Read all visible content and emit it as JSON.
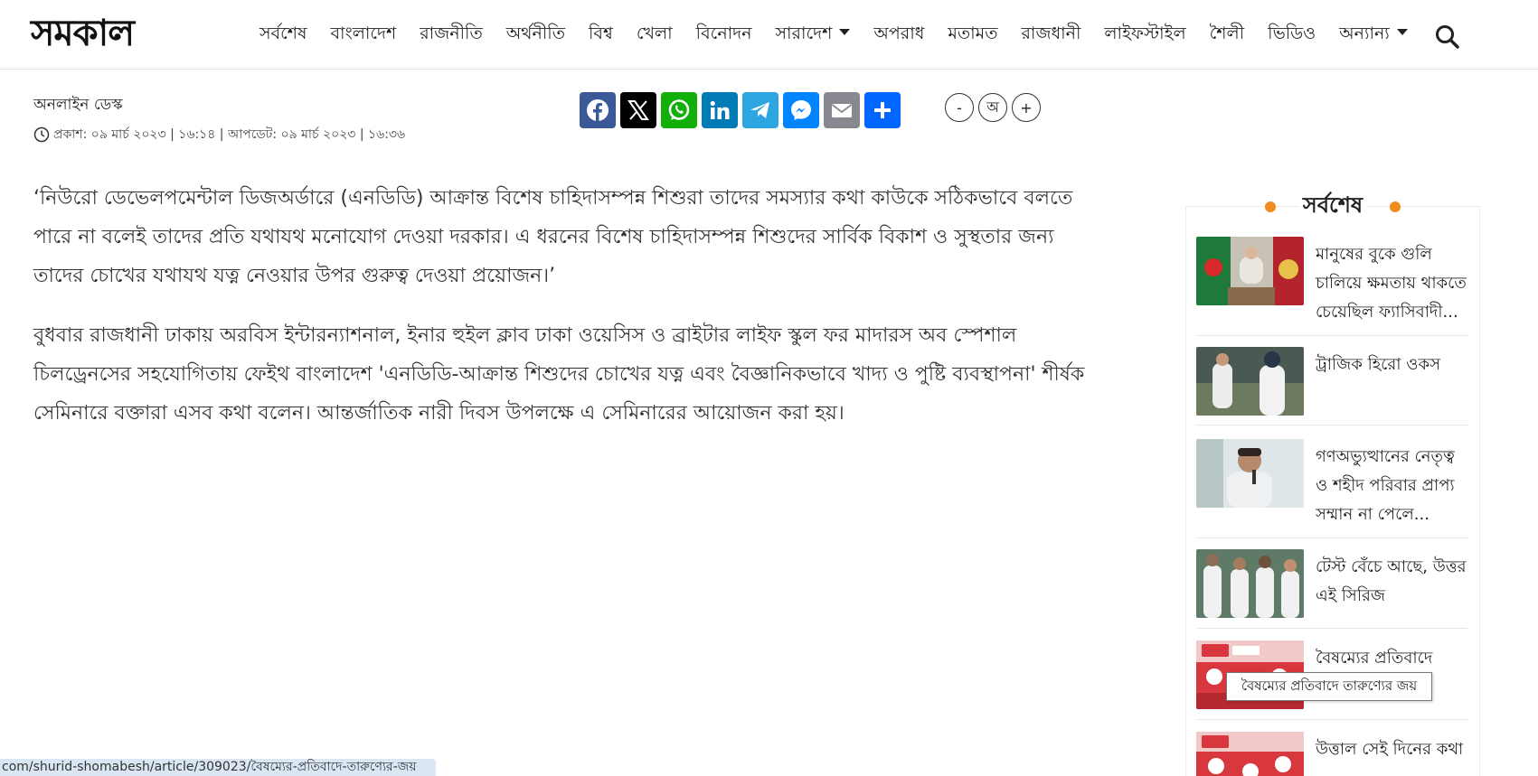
{
  "header": {
    "logo": "সমকাল",
    "nav": [
      {
        "label": "সর্বশেষ"
      },
      {
        "label": "বাংলাদেশ"
      },
      {
        "label": "রাজনীতি"
      },
      {
        "label": "অর্থনীতি"
      },
      {
        "label": "বিশ্ব"
      },
      {
        "label": "খেলা"
      },
      {
        "label": "বিনোদন"
      },
      {
        "label": "সারাদেশ"
      },
      {
        "label": "অপরাধ"
      },
      {
        "label": "মতামত"
      },
      {
        "label": "রাজধানী"
      },
      {
        "label": "লাইফস্টাইল"
      },
      {
        "label": "শৈলী"
      },
      {
        "label": "ভিডিও"
      },
      {
        "label": "অন্যান্য"
      }
    ],
    "search_icon": "search-icon"
  },
  "meta": {
    "author": "অনলাইন ডেস্ক",
    "dates": "প্রকাশ: ০৯ মার্চ ২০২৩ | ১৬:১৪ | আপডেট: ০৯ মার্চ ২০২৩ | ১৬:৩৬"
  },
  "share": {
    "buttons": [
      {
        "icon": "facebook-icon",
        "color": "#3b5998"
      },
      {
        "icon": "x-icon",
        "color": "#000000"
      },
      {
        "icon": "whatsapp-icon",
        "color": "#12af0a"
      },
      {
        "icon": "linkedin-icon",
        "color": "#007bb5"
      },
      {
        "icon": "telegram-icon",
        "color": "#2ca5e0"
      },
      {
        "icon": "messenger-icon",
        "color": "#0084ff"
      },
      {
        "icon": "email-icon",
        "color": "#888990"
      },
      {
        "icon": "share-icon",
        "color": "#0166ff"
      }
    ]
  },
  "font_controls": {
    "decrease": "-",
    "reset": "অ",
    "increase": "+"
  },
  "article": {
    "paragraphs": [
      "‘নিউরো ডেভেলপমেন্টাল ডিজঅর্ডারে (এনডিডি) আক্রান্ত বিশেষ চাহিদাসম্পন্ন শিশুরা তাদের সমস্যার কথা কাউকে সঠিকভাবে বলতে পারে না বলেই তাদের প্রতি যথাযথ মনোযোগ দেওয়া দরকার। এ ধরনের বিশেষ চাহিদাসম্পন্ন শিশুদের সার্বিক বিকাশ ও সুস্থতার জন্য তাদের চোখের যথাযথ যত্ন নেওয়ার উপর গুরুত্ব দেওয়া প্রয়োজন।’",
      "বুধবার রাজধানী ঢাকায় অরবিস ইন্টারন্যাশনাল, ইনার হুইল ক্লাব ঢাকা ওয়েসিস ও ব্রাইটার লাইফ স্কুল ফর মাদারস অব স্পেশাল চিলড্রেনসের সহযোগিতায় ফেইথ বাংলাদেশ  'এনডিডি-আক্রান্ত শিশুদের চোখের যত্ন এবং বৈজ্ঞানিকভাবে খাদ্য ও পুষ্টি ব্যবস্থাপনা' শীর্ষক সেমিনারে বক্তারা এসব কথা বলেন। আন্তর্জাতিক নারী দিবস উপলক্ষে এ সেমিনারের আয়োজন করা হয়।"
    ]
  },
  "sidebar": {
    "title": "সর্বশেষ",
    "accent": "#f08c1e",
    "items": [
      {
        "text": "মানুষের বুকে গুলি চালিয়ে ক্ষমতায় থাকতে চেয়েছিল ফ্যাসিবাদী..."
      },
      {
        "text": "ট্রাজিক হিরো ওকস"
      },
      {
        "text": "গণঅভ্যুত্থানের নেতৃত্ব ও শহীদ পরিবার প্রাপ্য সম্মান না পেলে..."
      },
      {
        "text": "টেস্ট বেঁচে আছে, উত্তর এই সিরিজ"
      },
      {
        "text": "বৈষম্যের প্রতিবাদে"
      },
      {
        "text": "উত্তাল সেই দিনের কথা"
      }
    ]
  },
  "tooltip": "বৈষম্যের প্রতিবাদে তারুণ্যের জয়",
  "status_url": "com/shurid-shomabesh/article/309023/বৈষম্যের-প্রতিবাদে-তারুণ্যের-জয়"
}
